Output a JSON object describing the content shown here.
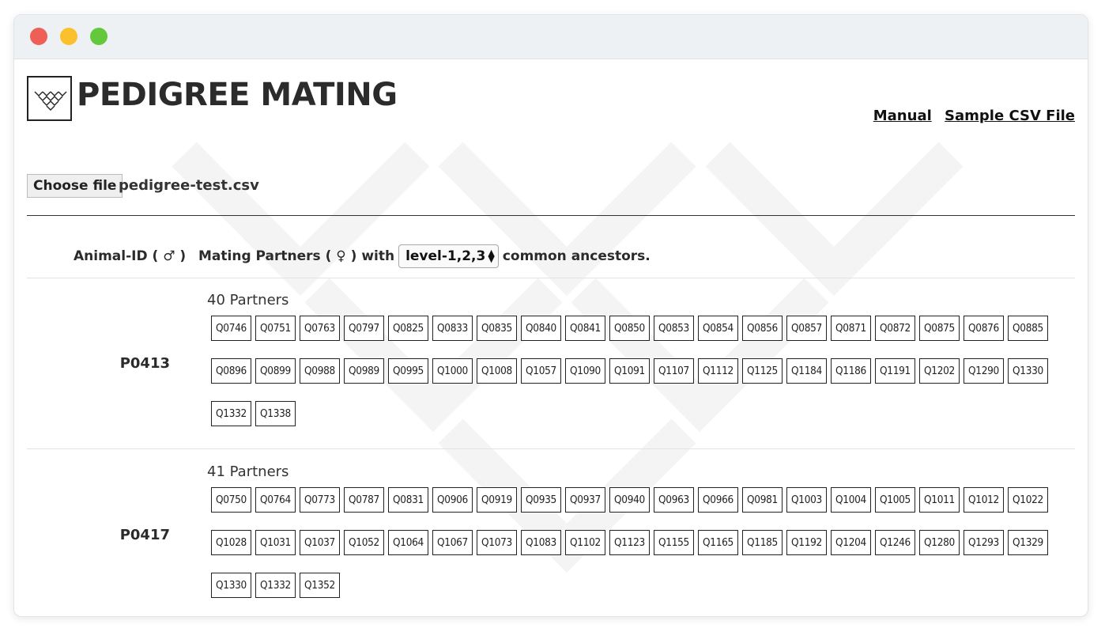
{
  "window": {
    "controls": {
      "close_color": "#ee5f58",
      "minimize_color": "#fbc12d",
      "zoom_color": "#63c83b"
    }
  },
  "header": {
    "logo_icon": "pedigree-chevrons-logo",
    "title": "PEDIGREE MATING",
    "links": {
      "manual": "Manual",
      "sample_csv": "Sample CSV File"
    }
  },
  "file": {
    "button_label": "Choose file",
    "file_name": "pedigree-test.csv"
  },
  "table_header": {
    "animal_label": "Animal-ID ( ♂ )",
    "partners_prefix": "Mating Partners ( ♀ ) with",
    "level_selected": "level-1,2,3",
    "partners_suffix": "common ancestors."
  },
  "rows": [
    {
      "animal_id": "P0413",
      "partners_count": "40 Partners",
      "partners": [
        "Q0746",
        "Q0751",
        "Q0763",
        "Q0797",
        "Q0825",
        "Q0833",
        "Q0835",
        "Q0840",
        "Q0841",
        "Q0850",
        "Q0853",
        "Q0854",
        "Q0856",
        "Q0857",
        "Q0871",
        "Q0872",
        "Q0875",
        "Q0876",
        "Q0885",
        "Q0896",
        "Q0899",
        "Q0988",
        "Q0989",
        "Q0995",
        "Q1000",
        "Q1008",
        "Q1057",
        "Q1090",
        "Q1091",
        "Q1107",
        "Q1112",
        "Q1125",
        "Q1184",
        "Q1186",
        "Q1191",
        "Q1202",
        "Q1290",
        "Q1330",
        "Q1332",
        "Q1338"
      ]
    },
    {
      "animal_id": "P0417",
      "partners_count": "41 Partners",
      "partners": [
        "Q0750",
        "Q0764",
        "Q0773",
        "Q0787",
        "Q0831",
        "Q0906",
        "Q0919",
        "Q0935",
        "Q0937",
        "Q0940",
        "Q0963",
        "Q0966",
        "Q0981",
        "Q1003",
        "Q1004",
        "Q1005",
        "Q1011",
        "Q1012",
        "Q1022",
        "Q1028",
        "Q1031",
        "Q1037",
        "Q1052",
        "Q1064",
        "Q1067",
        "Q1073",
        "Q1083",
        "Q1102",
        "Q1123",
        "Q1155",
        "Q1165",
        "Q1185",
        "Q1192",
        "Q1204",
        "Q1246",
        "Q1280",
        "Q1293",
        "Q1329",
        "Q1330",
        "Q1332",
        "Q1352"
      ]
    }
  ]
}
